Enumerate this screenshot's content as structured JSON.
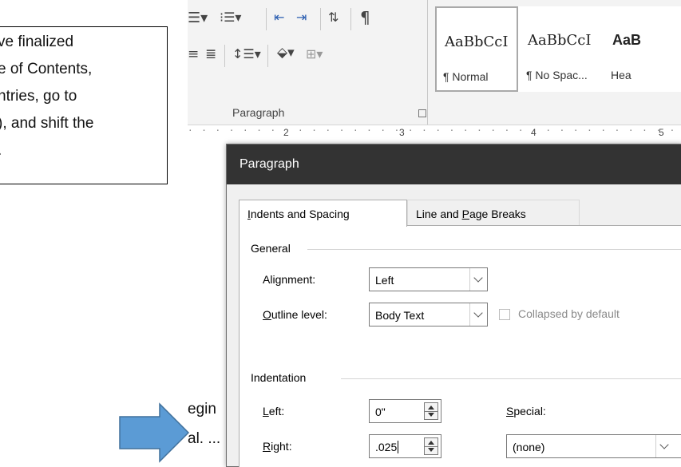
{
  "note": {
    "lines": [
      "ve finalized",
      "e of Contents,",
      "ntries, go to",
      "), and shift the",
      "."
    ]
  },
  "document": {
    "fragments": [
      "egin",
      "al. ..."
    ]
  },
  "ribbon": {
    "group_label": "Paragraph",
    "styles": [
      {
        "sample": "AaBbCcI",
        "name": "¶ Normal",
        "selected": true
      },
      {
        "sample": "AaBbCcI",
        "name": "¶ No Spac...",
        "selected": false
      },
      {
        "sample": "AaB",
        "name": "Hea",
        "selected": false
      }
    ]
  },
  "ruler": {
    "numbers": [
      "2",
      "3",
      "4",
      "5"
    ]
  },
  "dialog": {
    "title": "Paragraph",
    "tabs": [
      {
        "label_pre": "",
        "label_u": "I",
        "label_post": "ndents and Spacing",
        "active": true
      },
      {
        "label_pre": "Line and ",
        "label_u": "P",
        "label_post": "age Breaks",
        "active": false
      }
    ],
    "general": {
      "heading": "General",
      "alignment_label_pre": "Ali",
      "alignment_label_u": "g",
      "alignment_label_post": "nment:",
      "alignment_value": "Left",
      "outline_label_pre": "",
      "outline_label_u": "O",
      "outline_label_post": "utline level:",
      "outline_value": "Body Text",
      "collapsed_label": "Collapsed by default"
    },
    "indentation": {
      "heading": "Indentation",
      "left_label_u": "L",
      "left_label_post": "eft:",
      "left_value": "0\"",
      "right_label_u": "R",
      "right_label_post": "ight:",
      "right_value": ".025",
      "special_label_u": "S",
      "special_label_post": "pecial:",
      "special_value": "(none)"
    }
  },
  "colors": {
    "arrow": "#5b9bd5",
    "arrow_border": "#41719c",
    "titlebar": "#333333"
  }
}
